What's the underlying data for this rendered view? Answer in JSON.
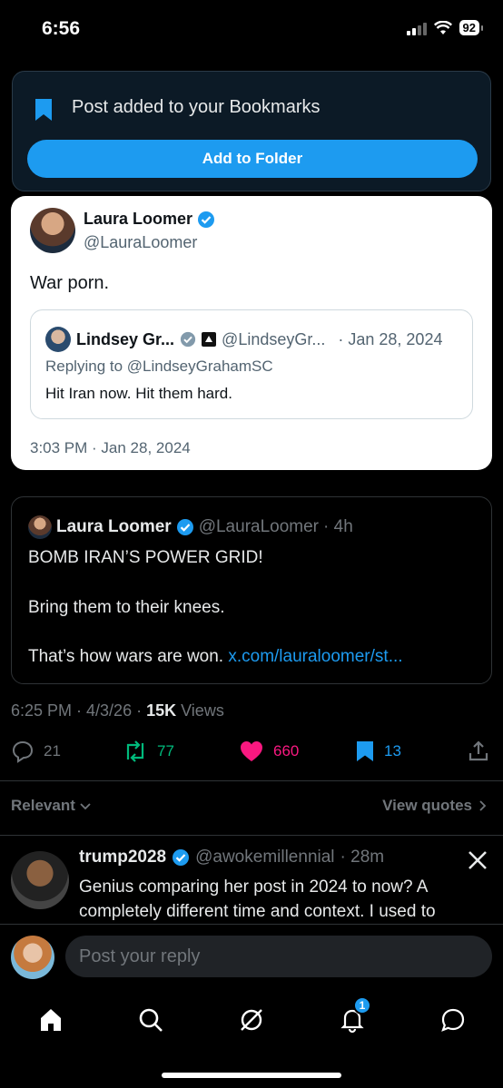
{
  "status": {
    "time": "6:56",
    "battery": "92"
  },
  "toast": {
    "message": "Post added to your Bookmarks",
    "button": "Add to Folder"
  },
  "quoted_card": {
    "name": "Laura Loomer",
    "handle": "@LauraLoomer",
    "text": "War porn.",
    "inner": {
      "name": "Lindsey Gr...",
      "handle": "@LindseyGr...",
      "date": "· Jan 28, 2024",
      "replying": "Replying to @LindseyGrahamSC",
      "text": "Hit Iran now. Hit them hard."
    },
    "timestamp": "3:03 PM · Jan 28, 2024"
  },
  "embed": {
    "name": "Laura Loomer",
    "handle": "@LauraLoomer",
    "age": "· 4h",
    "line1": "BOMB IRAN’S POWER GRID!",
    "line2": "Bring them to their knees.",
    "line3": "That’s how wars are won.",
    "link": "x.com/lauraloomer/st..."
  },
  "meta": {
    "time": "6:25 PM · 4/3/26 · ",
    "views": "15K",
    "views_label": "Views"
  },
  "actions": {
    "replies": "21",
    "reposts": "77",
    "likes": "660",
    "bookmarks": "13"
  },
  "colors": {
    "accent": "#1d9bf0",
    "repost": "#00ba7c",
    "like": "#f91880"
  },
  "filters": {
    "relevant": "Relevant",
    "view_quotes": "View quotes"
  },
  "reply": {
    "name": "trump2028",
    "handle": "@awokemillennial",
    "age": "· 28m",
    "text": "Genius comparing her post in 2024 to now? A completely different time and context. I used to"
  },
  "compose": {
    "placeholder": "Post your reply"
  },
  "tabs": {
    "notifications_badge": "1"
  }
}
